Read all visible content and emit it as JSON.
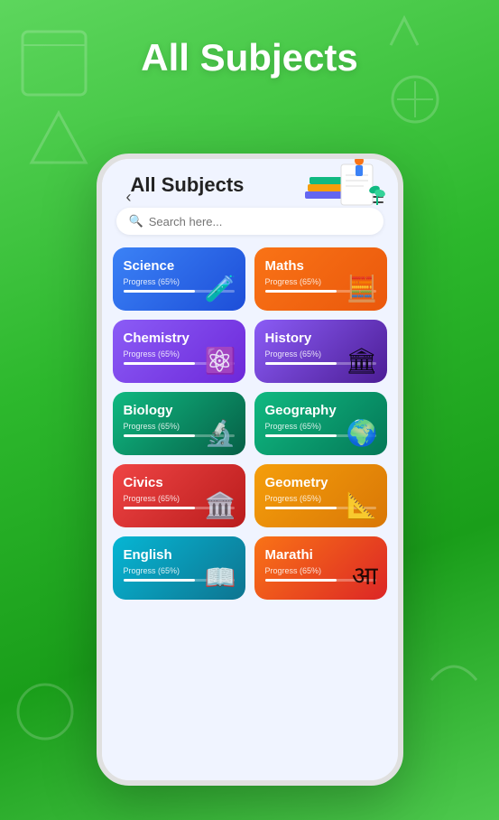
{
  "app": {
    "bg_title": "All Subjects"
  },
  "header": {
    "back_label": "‹",
    "title": "All Subjects"
  },
  "search": {
    "placeholder": "Search here..."
  },
  "subjects": [
    {
      "id": "science",
      "name": "Science",
      "progress": "Progress (65%)",
      "fill": 65,
      "color": "card-science",
      "icon": "🧪",
      "full": false
    },
    {
      "id": "maths",
      "name": "Maths",
      "progress": "Progress (65%)",
      "fill": 65,
      "color": "card-maths",
      "icon": "🧮",
      "full": false
    },
    {
      "id": "chemistry",
      "name": "Chemistry",
      "progress": "Progress (65%)",
      "fill": 65,
      "color": "card-chemistry",
      "icon": "⚛️",
      "full": false
    },
    {
      "id": "history",
      "name": "History",
      "progress": "Progress (65%)",
      "fill": 65,
      "color": "card-history",
      "icon": "🏛",
      "full": false
    },
    {
      "id": "biology",
      "name": "Biology",
      "progress": "Progress (65%)",
      "fill": 65,
      "color": "card-biology",
      "icon": "🔬",
      "full": false
    },
    {
      "id": "geography",
      "name": "Geography",
      "progress": "Progress (65%)",
      "fill": 65,
      "color": "card-geography",
      "icon": "🌍",
      "full": false
    },
    {
      "id": "civics",
      "name": "Civics",
      "progress": "Progress (65%)",
      "fill": 65,
      "color": "card-civics",
      "icon": "🏛️",
      "full": false
    },
    {
      "id": "geometry",
      "name": "Geometry",
      "progress": "Progress (65%)",
      "fill": 65,
      "color": "card-geometry",
      "icon": "📐",
      "full": false
    },
    {
      "id": "english",
      "name": "English",
      "progress": "Progress (65%)",
      "fill": 65,
      "color": "card-english",
      "icon": "📖",
      "full": false
    },
    {
      "id": "marathi",
      "name": "Marathi",
      "progress": "Progress (65%)",
      "fill": 65,
      "color": "card-marathi",
      "icon": "आ",
      "full": false
    }
  ]
}
